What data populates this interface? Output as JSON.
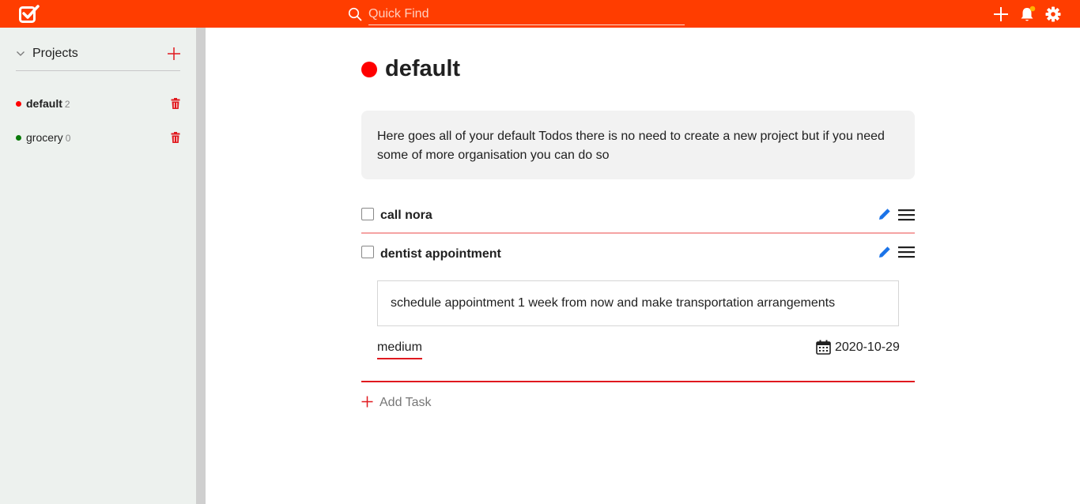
{
  "colors": {
    "brand": "#ff3d00",
    "accent_red": "#e0191e",
    "project_default": "#ff0000",
    "project_grocery": "#0a7a0a",
    "edit_blue": "#1a73e8",
    "bell_badge": "#ffb300"
  },
  "topbar": {
    "logo_icon": "checkbox-logo-icon",
    "search_placeholder": "Quick Find",
    "search_value": "",
    "icons": [
      "plus-icon",
      "bell-icon",
      "gear-icon"
    ]
  },
  "sidebar": {
    "section_title": "Projects",
    "projects": [
      {
        "name": "default",
        "count": "2",
        "color": "#ff0000",
        "active": true
      },
      {
        "name": "grocery",
        "count": "0",
        "color": "#0a7a0a",
        "active": false
      }
    ]
  },
  "main": {
    "title": "default",
    "description": "Here goes all of your default Todos there is no need to create a new project but if you need some of more organisation you can do so",
    "tasks": [
      {
        "title": "call nora",
        "expanded": false
      },
      {
        "title": "dentist appointment",
        "expanded": true,
        "note": "schedule appointment 1 week from now and make transportation arrangements",
        "priority": "medium",
        "due_date": "2020-10-29"
      }
    ],
    "add_task_label": "Add Task"
  }
}
